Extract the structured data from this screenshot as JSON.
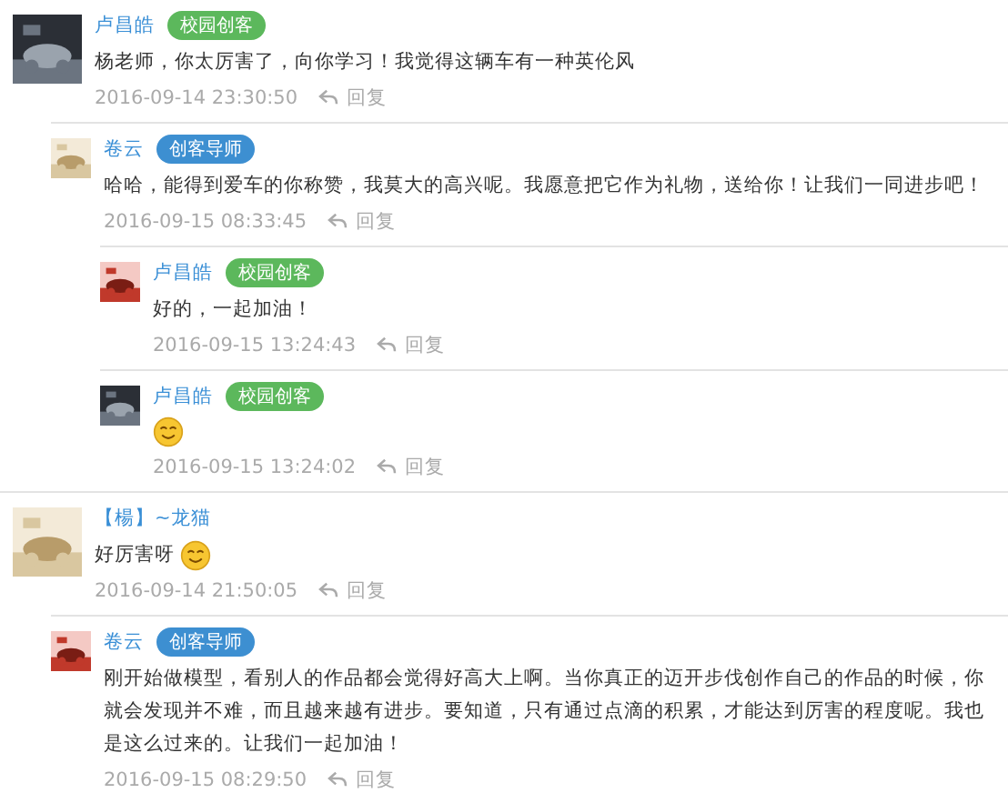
{
  "comments": [
    {
      "author": "卢昌皓",
      "badge": {
        "text": "校园创客",
        "color": "#5cb85c"
      },
      "text": "杨老师，你太厉害了，向你学习！我觉得这辆车有一种英伦风",
      "time": "2016-09-14 23:30:50",
      "reply": "回复",
      "children": [
        {
          "author": "卷云",
          "badge": {
            "text": "创客导师",
            "color": "#3d8fd1"
          },
          "text": "哈哈，能得到爱车的你称赞，我莫大的高兴呢。我愿意把它作为礼物，送给你！让我们一同进步吧！",
          "time": "2016-09-15 08:33:45",
          "reply": "回复",
          "children": [
            {
              "author": "卢昌皓",
              "badge": {
                "text": "校园创客",
                "color": "#5cb85c"
              },
              "text": "好的，一起加油！",
              "time": "2016-09-15 13:24:43",
              "reply": "回复"
            },
            {
              "author": "卢昌皓",
              "badge": {
                "text": "校园创客",
                "color": "#5cb85c"
              },
              "emoji": true,
              "time": "2016-09-15 13:24:02",
              "reply": "回复"
            }
          ]
        }
      ]
    },
    {
      "author": "【楊】~龙猫",
      "text": "好厉害呀",
      "emoji": true,
      "time": "2016-09-14 21:50:05",
      "reply": "回复",
      "children": [
        {
          "author": "卷云",
          "badge": {
            "text": "创客导师",
            "color": "#3d8fd1"
          },
          "text": "刚开始做模型，看别人的作品都会觉得好高大上啊。当你真正的迈开步伐创作自己的作品的时候，你就会发现并不难，而且越来越有进步。要知道，只有通过点滴的积累，才能达到厉害的程度呢。我也是这么过来的。让我们一起加油！",
          "time": "2016-09-15 08:29:50",
          "reply": "回复"
        }
      ]
    }
  ]
}
